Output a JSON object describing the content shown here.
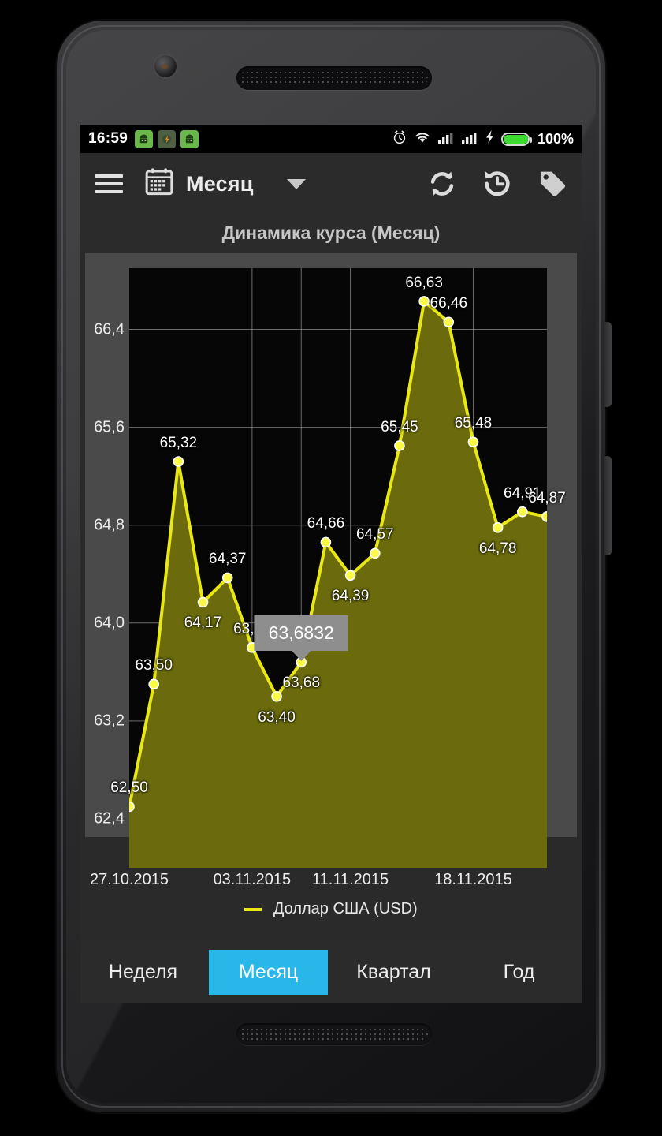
{
  "statusbar": {
    "time": "16:59",
    "battery_percent": "100%",
    "icons": [
      "notification-app-icon",
      "notification-app-icon",
      "notification-app-icon",
      "alarm-icon",
      "wifi-icon",
      "signal-icon",
      "signal-icon",
      "charging-bolt-icon",
      "battery-icon"
    ]
  },
  "toolbar": {
    "menu_icon": "hamburger-menu-icon",
    "calendar_icon": "calendar-icon",
    "period_label": "Месяц",
    "dropdown_icon": "chevron-down-icon",
    "refresh_icon": "refresh-icon",
    "history_icon": "history-icon",
    "tag_icon": "tag-icon"
  },
  "chart_title": "Динамика курса (Месяц)",
  "tooltip": {
    "value": "63,6832"
  },
  "tabs": [
    {
      "label": "Неделя",
      "active": false
    },
    {
      "label": "Месяц",
      "active": true
    },
    {
      "label": "Квартал",
      "active": false
    },
    {
      "label": "Год",
      "active": false
    }
  ],
  "colors": {
    "series": "#e9e814",
    "fill": "#6b6b0d",
    "accent": "#29b6e8",
    "plot_bg": "#060606",
    "panel_bg": "#4a4a4a",
    "toolbar_bg": "#2b2b2b"
  },
  "chart_data": {
    "type": "line",
    "title": "Динамика курса (Месяц)",
    "xlabel": "",
    "ylabel": "",
    "grid": true,
    "legend_position": "bottom",
    "series": [
      {
        "name": "Доллар США (USD)",
        "color": "#e9e814",
        "filled": true,
        "values": [
          62.5,
          63.5,
          65.32,
          64.17,
          64.37,
          63.8,
          63.4,
          63.68,
          64.66,
          64.39,
          64.57,
          65.45,
          66.63,
          66.46,
          65.48,
          64.78,
          64.91,
          64.87
        ],
        "labels": [
          "62,50",
          "63,50",
          "65,32",
          "64,17",
          "64,37",
          "63,80",
          "63,40",
          "63,68",
          "64,66",
          "64,39",
          "64,57",
          "65,45",
          "66,63",
          "66,46",
          "65,48",
          "64,78",
          "64,91",
          "64,87"
        ]
      }
    ],
    "ylim": [
      62.0,
      66.9
    ],
    "yticks": [
      62.4,
      63.2,
      64.0,
      64.8,
      65.6,
      66.4
    ],
    "yticklabels": [
      "62,4",
      "63,2",
      "64,0",
      "64,8",
      "65,6",
      "66,4"
    ],
    "xticklabels": [
      "27.10.2015",
      "03.11.2015",
      "11.11.2015",
      "18.11.2015"
    ],
    "xtick_indices": [
      0,
      5,
      9,
      14
    ],
    "vgrid_indices": [
      5,
      7,
      9,
      14
    ],
    "highlighted_index": 7,
    "highlighted_value": "63,6832"
  }
}
